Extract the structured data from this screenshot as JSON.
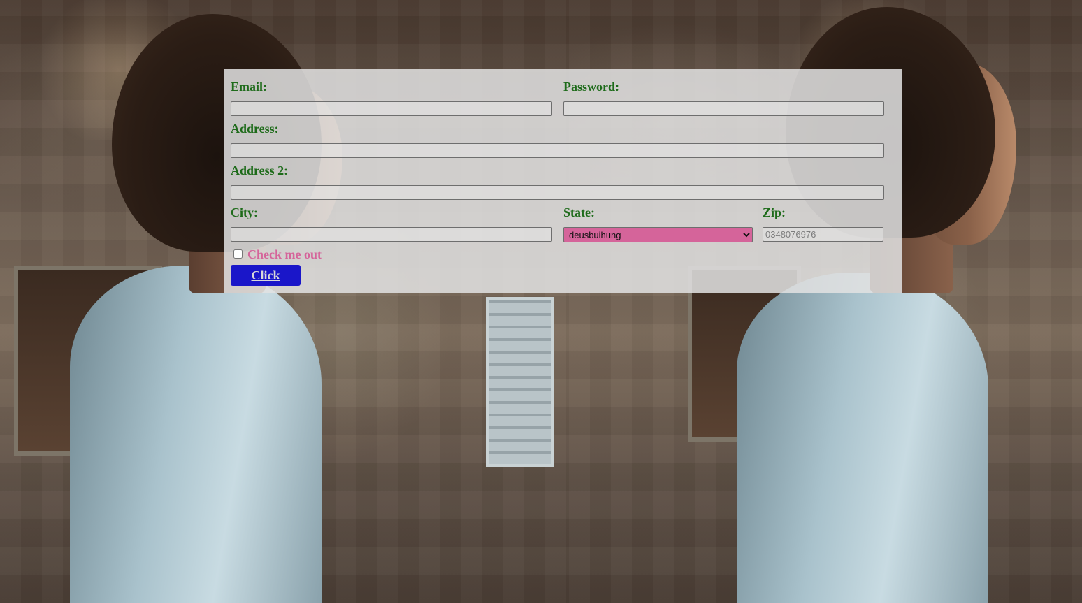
{
  "form": {
    "email_label": "Email:",
    "email_value": "",
    "password_label": "Password:",
    "password_value": "",
    "address_label": "Address:",
    "address_value": "",
    "address2_label": "Address 2:",
    "address2_value": "",
    "city_label": "City:",
    "city_value": "",
    "state_label": "State:",
    "state_selected": "deusbuihung",
    "zip_label": "Zip:",
    "zip_placeholder": "0348076976",
    "checkbox_label": "Check me out",
    "checkbox_checked": false,
    "submit_label": "Click"
  },
  "colors": {
    "label_green": "#1e6b1a",
    "checkbox_label_pink": "#d5649a",
    "select_background_pink": "#d5649a",
    "button_blue": "#1a16c9",
    "panel_background": "#e2e2e2"
  },
  "background": {
    "image": "photo-of-young-man-in-white-t-shirt-profile-mirrored"
  }
}
